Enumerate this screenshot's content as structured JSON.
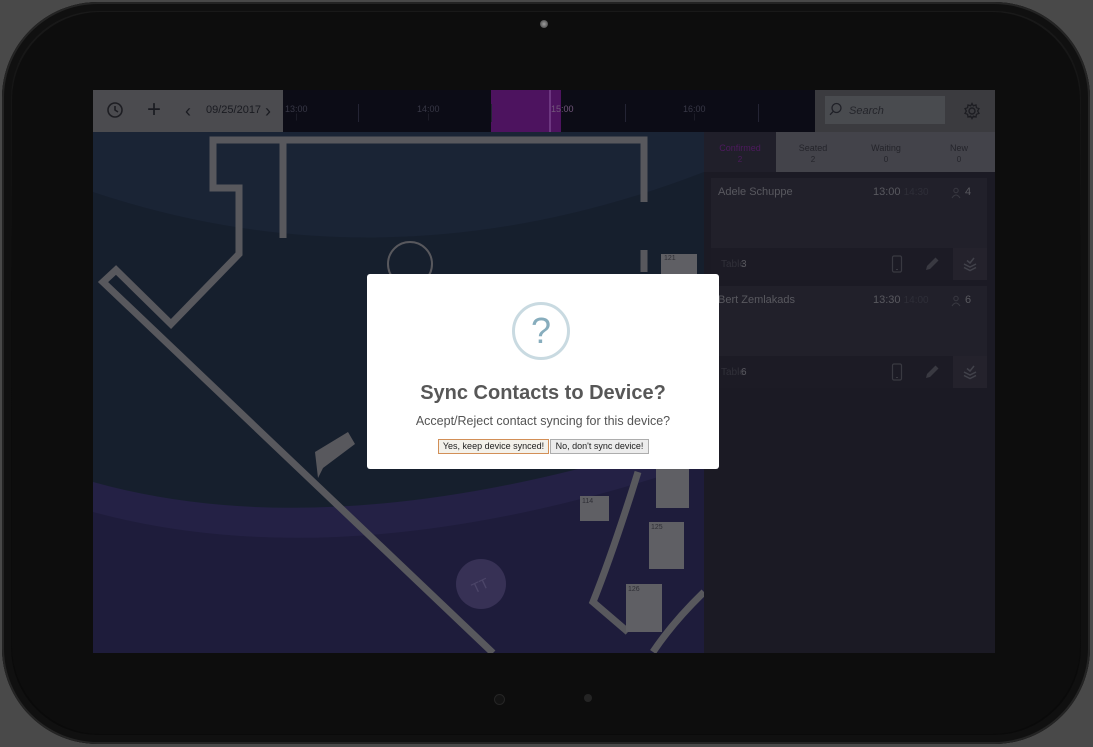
{
  "toolbar": {
    "date": "09/25/2017",
    "time_labels": [
      "13:00",
      "14:00",
      "15:00",
      "16:00"
    ],
    "search_placeholder": "Search"
  },
  "tabs": [
    {
      "label": "Confirmed",
      "count": "2"
    },
    {
      "label": "Seated",
      "count": "2"
    },
    {
      "label": "Waiting",
      "count": "0"
    },
    {
      "label": "New",
      "count": "0"
    }
  ],
  "reservations": [
    {
      "name": "Adele Schuppe",
      "start": "13:00",
      "end": "14:30",
      "party": "4",
      "table_label": "Table",
      "table": "3"
    },
    {
      "name": "Bert Zemlakads",
      "start": "13:30",
      "end": "14:00",
      "party": "6",
      "table_label": "Table",
      "table": "6"
    }
  ],
  "floor_tables": [
    "121",
    "114",
    "125",
    "126"
  ],
  "dialog": {
    "title": "Sync Contacts to Device?",
    "text": "Accept/Reject contact syncing for this device?",
    "icon_glyph": "?",
    "confirm_label": "Yes, keep device synced!",
    "cancel_label": "No, don't sync device!"
  },
  "colors": {
    "accent": "#7d1f9a",
    "confirm_border": "#d28f57"
  }
}
